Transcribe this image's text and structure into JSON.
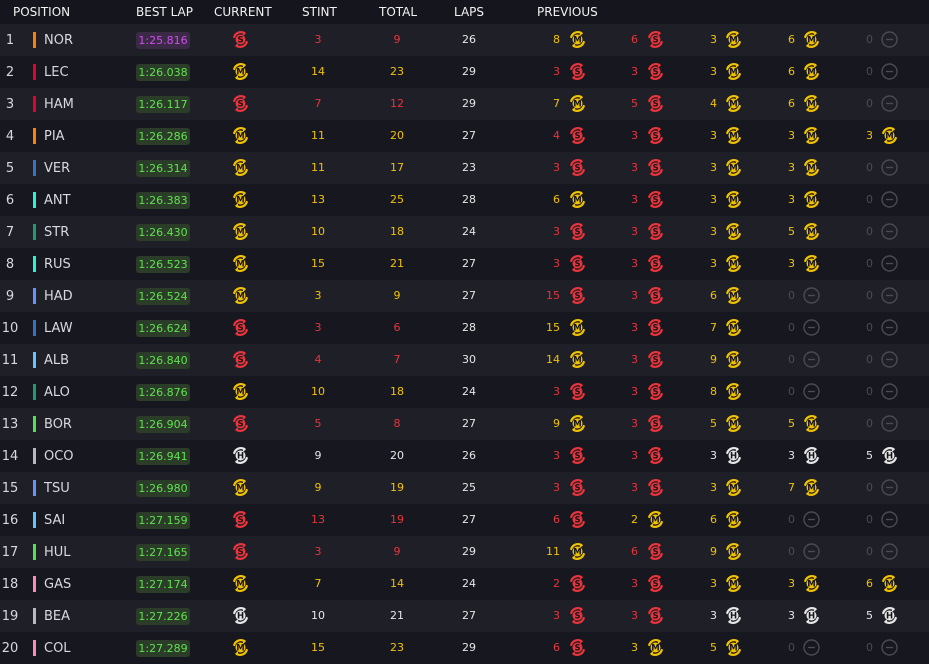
{
  "headers": {
    "position": "POSITION",
    "best_lap": "BEST LAP",
    "current": "CURRENT",
    "stint": "STINT",
    "total": "TOTAL",
    "laps": "LAPS",
    "previous": "PREVIOUS"
  },
  "colors": {
    "soft": "#e8343b",
    "medium": "#f1c200",
    "hard": "#e6e6e6",
    "none": "#4b4b55",
    "lap_green": "#5fe34f",
    "lap_purple": "#d24cf0"
  },
  "rows": [
    {
      "pos": "1",
      "driver": "NOR",
      "team_color": "#ff8000",
      "best_lap": "1:25.816",
      "fastest": true,
      "current": "S",
      "stint": "3",
      "total": "9",
      "laps": "26",
      "previous": [
        {
          "n": "8",
          "t": "M"
        },
        {
          "n": "6",
          "t": "S"
        },
        {
          "n": "3",
          "t": "M"
        },
        {
          "n": "6",
          "t": "M"
        },
        {
          "n": "0",
          "t": "-"
        }
      ]
    },
    {
      "pos": "2",
      "driver": "LEC",
      "team_color": "#e8002d",
      "best_lap": "1:26.038",
      "fastest": false,
      "current": "M",
      "stint": "14",
      "total": "23",
      "laps": "29",
      "previous": [
        {
          "n": "3",
          "t": "S"
        },
        {
          "n": "3",
          "t": "S"
        },
        {
          "n": "3",
          "t": "M"
        },
        {
          "n": "6",
          "t": "M"
        },
        {
          "n": "0",
          "t": "-"
        }
      ]
    },
    {
      "pos": "3",
      "driver": "HAM",
      "team_color": "#e8002d",
      "best_lap": "1:26.117",
      "fastest": false,
      "current": "S",
      "stint": "7",
      "total": "12",
      "laps": "29",
      "previous": [
        {
          "n": "7",
          "t": "M"
        },
        {
          "n": "5",
          "t": "S"
        },
        {
          "n": "4",
          "t": "M"
        },
        {
          "n": "6",
          "t": "M"
        },
        {
          "n": "0",
          "t": "-"
        }
      ]
    },
    {
      "pos": "4",
      "driver": "PIA",
      "team_color": "#ff8000",
      "best_lap": "1:26.286",
      "fastest": false,
      "current": "M",
      "stint": "11",
      "total": "20",
      "laps": "27",
      "previous": [
        {
          "n": "4",
          "t": "S"
        },
        {
          "n": "3",
          "t": "S"
        },
        {
          "n": "3",
          "t": "M"
        },
        {
          "n": "3",
          "t": "M"
        },
        {
          "n": "3",
          "t": "M"
        }
      ]
    },
    {
      "pos": "5",
      "driver": "VER",
      "team_color": "#3671c6",
      "best_lap": "1:26.314",
      "fastest": false,
      "current": "M",
      "stint": "11",
      "total": "17",
      "laps": "23",
      "previous": [
        {
          "n": "3",
          "t": "S"
        },
        {
          "n": "3",
          "t": "S"
        },
        {
          "n": "3",
          "t": "M"
        },
        {
          "n": "3",
          "t": "M"
        },
        {
          "n": "0",
          "t": "-"
        }
      ]
    },
    {
      "pos": "6",
      "driver": "ANT",
      "team_color": "#27f4d2",
      "best_lap": "1:26.383",
      "fastest": false,
      "current": "M",
      "stint": "13",
      "total": "25",
      "laps": "28",
      "previous": [
        {
          "n": "6",
          "t": "M"
        },
        {
          "n": "3",
          "t": "S"
        },
        {
          "n": "3",
          "t": "M"
        },
        {
          "n": "3",
          "t": "M"
        },
        {
          "n": "0",
          "t": "-"
        }
      ]
    },
    {
      "pos": "7",
      "driver": "STR",
      "team_color": "#229971",
      "best_lap": "1:26.430",
      "fastest": false,
      "current": "M",
      "stint": "10",
      "total": "18",
      "laps": "24",
      "previous": [
        {
          "n": "3",
          "t": "S"
        },
        {
          "n": "3",
          "t": "S"
        },
        {
          "n": "3",
          "t": "M"
        },
        {
          "n": "5",
          "t": "M"
        },
        {
          "n": "0",
          "t": "-"
        }
      ]
    },
    {
      "pos": "8",
      "driver": "RUS",
      "team_color": "#27f4d2",
      "best_lap": "1:26.523",
      "fastest": false,
      "current": "M",
      "stint": "15",
      "total": "21",
      "laps": "27",
      "previous": [
        {
          "n": "3",
          "t": "S"
        },
        {
          "n": "3",
          "t": "S"
        },
        {
          "n": "3",
          "t": "M"
        },
        {
          "n": "3",
          "t": "M"
        },
        {
          "n": "0",
          "t": "-"
        }
      ]
    },
    {
      "pos": "9",
      "driver": "HAD",
      "team_color": "#6692ff",
      "best_lap": "1:26.524",
      "fastest": false,
      "current": "M",
      "stint": "3",
      "total": "9",
      "laps": "27",
      "previous": [
        {
          "n": "15",
          "t": "S"
        },
        {
          "n": "3",
          "t": "S"
        },
        {
          "n": "6",
          "t": "M"
        },
        {
          "n": "0",
          "t": "-"
        },
        {
          "n": "0",
          "t": "-"
        }
      ]
    },
    {
      "pos": "10",
      "driver": "LAW",
      "team_color": "#3671c6",
      "best_lap": "1:26.624",
      "fastest": false,
      "current": "S",
      "stint": "3",
      "total": "6",
      "laps": "28",
      "previous": [
        {
          "n": "15",
          "t": "M"
        },
        {
          "n": "3",
          "t": "S"
        },
        {
          "n": "7",
          "t": "M"
        },
        {
          "n": "0",
          "t": "-"
        },
        {
          "n": "0",
          "t": "-"
        }
      ]
    },
    {
      "pos": "11",
      "driver": "ALB",
      "team_color": "#64c4ff",
      "best_lap": "1:26.840",
      "fastest": false,
      "current": "S",
      "stint": "4",
      "total": "7",
      "laps": "30",
      "previous": [
        {
          "n": "14",
          "t": "M"
        },
        {
          "n": "3",
          "t": "S"
        },
        {
          "n": "9",
          "t": "M"
        },
        {
          "n": "0",
          "t": "-"
        },
        {
          "n": "0",
          "t": "-"
        }
      ]
    },
    {
      "pos": "12",
      "driver": "ALO",
      "team_color": "#229971",
      "best_lap": "1:26.876",
      "fastest": false,
      "current": "M",
      "stint": "10",
      "total": "18",
      "laps": "24",
      "previous": [
        {
          "n": "3",
          "t": "S"
        },
        {
          "n": "3",
          "t": "S"
        },
        {
          "n": "8",
          "t": "M"
        },
        {
          "n": "0",
          "t": "-"
        },
        {
          "n": "0",
          "t": "-"
        }
      ]
    },
    {
      "pos": "13",
      "driver": "BOR",
      "team_color": "#52e252",
      "best_lap": "1:26.904",
      "fastest": false,
      "current": "S",
      "stint": "5",
      "total": "8",
      "laps": "27",
      "previous": [
        {
          "n": "9",
          "t": "M"
        },
        {
          "n": "3",
          "t": "S"
        },
        {
          "n": "5",
          "t": "M"
        },
        {
          "n": "5",
          "t": "M"
        },
        {
          "n": "0",
          "t": "-"
        }
      ]
    },
    {
      "pos": "14",
      "driver": "OCO",
      "team_color": "#b6babd",
      "best_lap": "1:26.941",
      "fastest": false,
      "current": "H",
      "stint": "9",
      "total": "20",
      "laps": "26",
      "previous": [
        {
          "n": "3",
          "t": "S"
        },
        {
          "n": "3",
          "t": "S"
        },
        {
          "n": "3",
          "t": "H"
        },
        {
          "n": "3",
          "t": "H"
        },
        {
          "n": "5",
          "t": "H"
        }
      ]
    },
    {
      "pos": "15",
      "driver": "TSU",
      "team_color": "#6692ff",
      "best_lap": "1:26.980",
      "fastest": false,
      "current": "M",
      "stint": "9",
      "total": "19",
      "laps": "25",
      "previous": [
        {
          "n": "3",
          "t": "S"
        },
        {
          "n": "3",
          "t": "S"
        },
        {
          "n": "3",
          "t": "M"
        },
        {
          "n": "7",
          "t": "M"
        },
        {
          "n": "0",
          "t": "-"
        }
      ]
    },
    {
      "pos": "16",
      "driver": "SAI",
      "team_color": "#64c4ff",
      "best_lap": "1:27.159",
      "fastest": false,
      "current": "S",
      "stint": "13",
      "total": "19",
      "laps": "27",
      "previous": [
        {
          "n": "6",
          "t": "S"
        },
        {
          "n": "2",
          "t": "M"
        },
        {
          "n": "6",
          "t": "M"
        },
        {
          "n": "0",
          "t": "-"
        },
        {
          "n": "0",
          "t": "-"
        }
      ]
    },
    {
      "pos": "17",
      "driver": "HUL",
      "team_color": "#52e252",
      "best_lap": "1:27.165",
      "fastest": false,
      "current": "S",
      "stint": "3",
      "total": "9",
      "laps": "29",
      "previous": [
        {
          "n": "11",
          "t": "M"
        },
        {
          "n": "6",
          "t": "S"
        },
        {
          "n": "9",
          "t": "M"
        },
        {
          "n": "0",
          "t": "-"
        },
        {
          "n": "0",
          "t": "-"
        }
      ]
    },
    {
      "pos": "18",
      "driver": "GAS",
      "team_color": "#ff87bc",
      "best_lap": "1:27.174",
      "fastest": false,
      "current": "M",
      "stint": "7",
      "total": "14",
      "laps": "24",
      "previous": [
        {
          "n": "2",
          "t": "S"
        },
        {
          "n": "3",
          "t": "S"
        },
        {
          "n": "3",
          "t": "M"
        },
        {
          "n": "3",
          "t": "M"
        },
        {
          "n": "6",
          "t": "M"
        }
      ]
    },
    {
      "pos": "19",
      "driver": "BEA",
      "team_color": "#b6babd",
      "best_lap": "1:27.226",
      "fastest": false,
      "current": "H",
      "stint": "10",
      "total": "21",
      "laps": "27",
      "previous": [
        {
          "n": "3",
          "t": "S"
        },
        {
          "n": "3",
          "t": "S"
        },
        {
          "n": "3",
          "t": "H"
        },
        {
          "n": "3",
          "t": "H"
        },
        {
          "n": "5",
          "t": "H"
        }
      ]
    },
    {
      "pos": "20",
      "driver": "COL",
      "team_color": "#ff87bc",
      "best_lap": "1:27.289",
      "fastest": false,
      "current": "M",
      "stint": "15",
      "total": "23",
      "laps": "29",
      "previous": [
        {
          "n": "6",
          "t": "S"
        },
        {
          "n": "3",
          "t": "M"
        },
        {
          "n": "5",
          "t": "M"
        },
        {
          "n": "0",
          "t": "-"
        },
        {
          "n": "0",
          "t": "-"
        }
      ]
    }
  ]
}
